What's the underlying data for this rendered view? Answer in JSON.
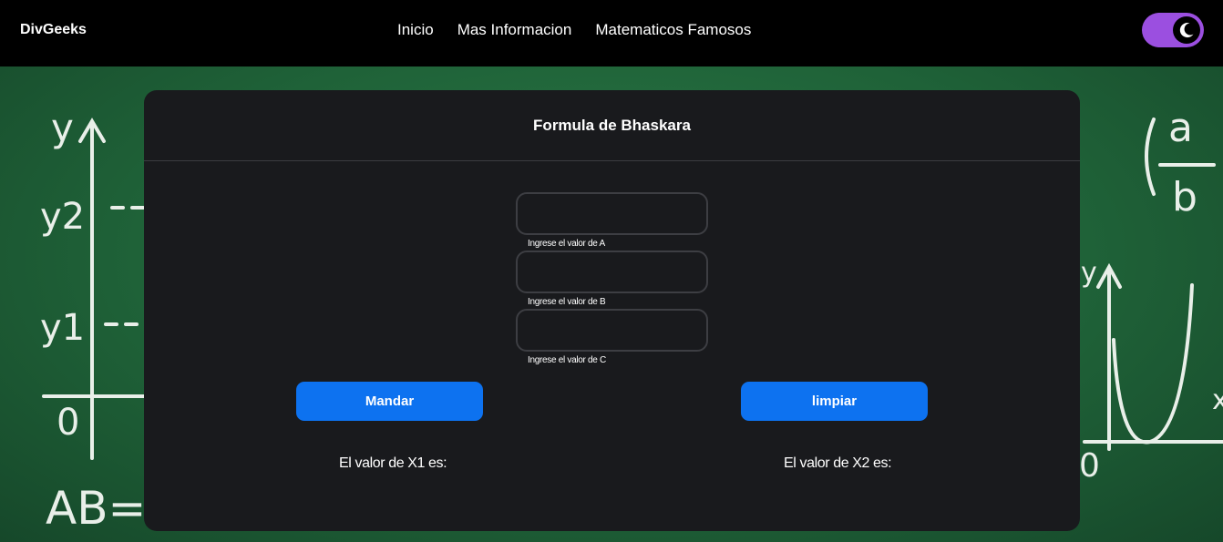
{
  "navbar": {
    "brand": "DivGeeks",
    "links": [
      "Inicio",
      "Mas Informacion",
      "Matematicos Famosos"
    ],
    "theme_toggle_icon": "moon-icon"
  },
  "card": {
    "title": "Formula de Bhaskara",
    "fields": [
      {
        "label": "Ingrese el valor de A",
        "value": ""
      },
      {
        "label": "Ingrese el valor de B",
        "value": ""
      },
      {
        "label": "Ingrese el valor de C",
        "value": ""
      }
    ],
    "buttons": {
      "submit": "Mandar",
      "clear": "limpiar"
    },
    "results": {
      "x1": "El valor de X1 es:",
      "x2": "El valor de X2 es:"
    }
  },
  "background": {
    "chalk_text": [
      "y",
      "y2",
      "y1",
      "0",
      "AB=",
      "a",
      "b",
      "y",
      "x",
      "0"
    ]
  },
  "colors": {
    "navbar": "#000000",
    "card": "#191a1d",
    "button": "#0d72f0",
    "toggle": "#9b4fe0",
    "board": "#1f6238"
  }
}
